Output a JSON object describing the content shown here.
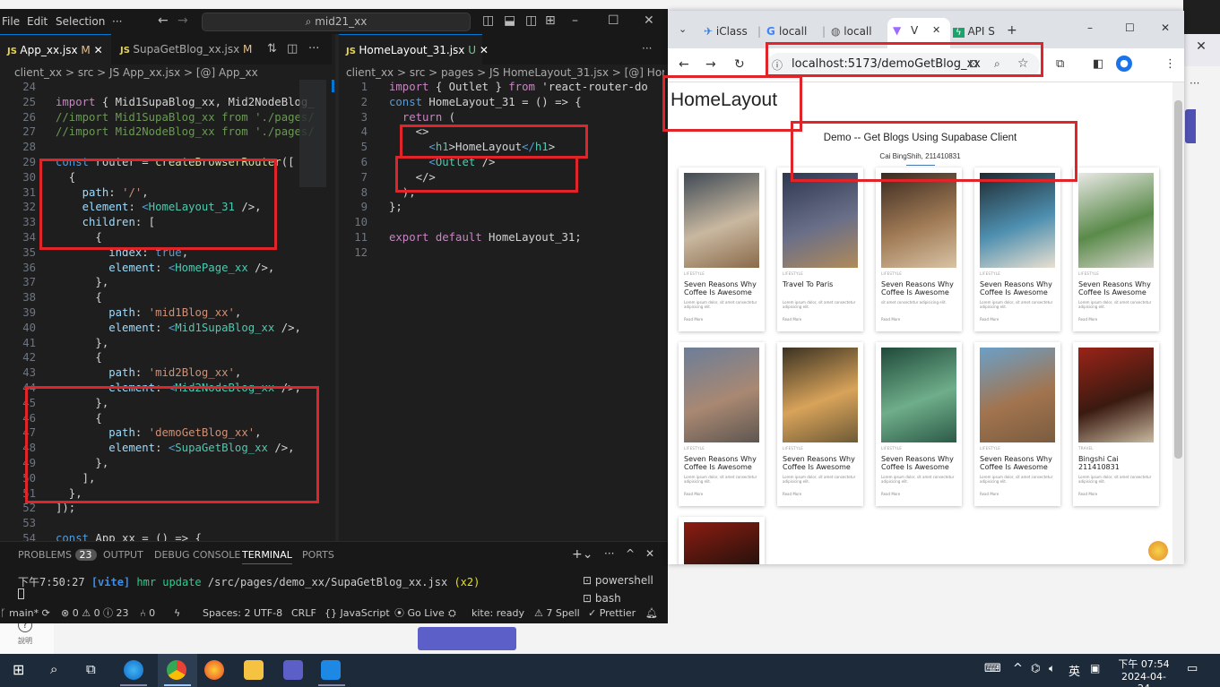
{
  "vscode": {
    "menu": [
      "File",
      "Edit",
      "Selection",
      "···"
    ],
    "search": "mid21_xx",
    "left_tabs": [
      {
        "label": "App_xx.jsx",
        "status": "M",
        "active": true
      },
      {
        "label": "SupaGetBlog_xx.jsx",
        "status": "M",
        "active": false
      }
    ],
    "right_tabs": [
      {
        "label": "HomeLayout_31.jsx",
        "status": "U",
        "active": true
      }
    ],
    "left_breadcrumb": "client_xx > src > JS App_xx.jsx > [@] App_xx",
    "right_breadcrumb": "client_xx > src > pages > JS HomeLayout_31.jsx > [@] HomeLayout_3",
    "left_line_numbers": [
      "24",
      "25",
      "26",
      "27",
      "28",
      "29",
      "30",
      "31",
      "32",
      "33",
      "34",
      "35",
      "36",
      "37",
      "38",
      "39",
      "40",
      "41",
      "42",
      "43",
      "44",
      "45",
      "46",
      "47",
      "48",
      "49",
      "50",
      "51",
      "52",
      "53",
      "54"
    ],
    "left_code": [
      "",
      "import { Mid1SupaBlog_xx, Mid2NodeBlog_",
      "//import Mid1SupaBlog_xx from './pages/",
      "//import Mid2NodeBlog_xx from './pages/",
      "",
      "const router = createBrowserRouter([",
      "  {",
      "    path: '/',",
      "    element: <HomeLayout_31 />,",
      "    children: [",
      "      {",
      "        index: true,",
      "        element: <HomePage_xx />,",
      "      },",
      "      {",
      "        path: 'mid1Blog_xx',",
      "        element: <Mid1SupaBlog_xx />,",
      "      },",
      "      {",
      "        path: 'mid2Blog_xx',",
      "        element: <Mid2NodeBlog_xx />,",
      "      },",
      "      {",
      "        path: 'demoGetBlog_xx',",
      "        element: <SupaGetBlog_xx />,",
      "      },",
      "    ],",
      "  },",
      "]);",
      "",
      "const App_xx = () => {"
    ],
    "right_line_numbers": [
      "1",
      "2",
      "3",
      "4",
      "5",
      "6",
      "7",
      "8",
      "9",
      "10",
      "11",
      "12"
    ],
    "right_code": [
      "import { Outlet } from 'react-router-do",
      "const HomeLayout_31 = () => {",
      "  return (",
      "    <>",
      "      <h1>HomeLayout</h1>",
      "      <Outlet />",
      "    </>",
      "  );",
      "};",
      "",
      "export default HomeLayout_31;",
      ""
    ],
    "panel_tabs": [
      "PROBLEMS",
      "OUTPUT",
      "DEBUG CONSOLE",
      "TERMINAL",
      "PORTS"
    ],
    "problems_count": "23",
    "terminal_time": "下午7:50:27",
    "terminal_tag": "[vite]",
    "terminal_msg": "hmr update",
    "terminal_path": "/src/pages/demo_xx/SupaGetBlog_xx.jsx",
    "terminal_count": "(x2)",
    "shells": [
      "powershell",
      "bash"
    ],
    "status": {
      "branch": "main*",
      "errors": "⊗ 0 ⚠ 0 ⓘ 23",
      "ports": "⑃ 0",
      "spaces": "Spaces: 2",
      "encoding": "UTF-8",
      "eol": "CRLF",
      "lang": "{} JavaScript",
      "golive": "Go Live",
      "kite": "kite: ready",
      "spell": "⚠ 7 Spell",
      "prettier": "✓ Prettier"
    }
  },
  "chrome": {
    "tabs": [
      {
        "label": "iClass"
      },
      {
        "label": "locall"
      },
      {
        "label": "locall"
      },
      {
        "label": "V"
      },
      {
        "label": "API S"
      }
    ],
    "url": "localhost:5173/demoGetBlog_xx"
  },
  "page": {
    "h1": "HomeLayout",
    "title": "Demo -- Get Blogs Using Supabase Client",
    "subtitle": "Cai BingShih, 211410831",
    "cards": [
      {
        "category": "LIFESTYLE",
        "title": "Seven Reasons Why Coffee Is Awesome",
        "desc": "Lorem ipsum dolor, sit amet consectetur adipisicing elit.",
        "more": "Read More",
        "img": [
          "#3f4a55",
          "#c9b8a0",
          "#8a6a4a"
        ]
      },
      {
        "category": "LIFESTYLE",
        "title": "Travel To Paris",
        "desc": "Lorem ipsum dolor, sit amet consectetur adipisicing elit.",
        "more": "Read More",
        "img": [
          "#2d3850",
          "#6a6f88",
          "#b08a5a"
        ]
      },
      {
        "category": "LIFESTYLE",
        "title": "Seven Reasons Why Coffee Is Awesome",
        "desc": "sit amet consectetur adipisicing elit.",
        "more": "Read More",
        "img": [
          "#3a2a20",
          "#a07a55",
          "#d8c3a5"
        ]
      },
      {
        "category": "LIFESTYLE",
        "title": "Seven Reasons Why Coffee Is Awesome",
        "desc": "Lorem ipsum dolor, sit amet consectetur adipisicing elit.",
        "more": "Read More",
        "img": [
          "#1e2a30",
          "#4e8fb0",
          "#e9e0d0"
        ]
      },
      {
        "category": "LIFESTYLE",
        "title": "Seven Reasons Why Coffee Is Awesome",
        "desc": "Lorem ipsum dolor, sit amet consectetur adipisicing elit.",
        "more": "Read More",
        "img": [
          "#e8e8e4",
          "#5a8a4a",
          "#d9d6cf"
        ]
      },
      {
        "category": "LIFESTYLE",
        "title": "Seven Reasons Why Coffee Is Awesome",
        "desc": "Lorem ipsum dolor, sit amet consectetur adipisicing elit.",
        "more": "Read More",
        "img": [
          "#6c7e98",
          "#a98872",
          "#5e5650"
        ]
      },
      {
        "category": "LIFESTYLE",
        "title": "Seven Reasons Why Coffee Is Awesome",
        "desc": "Lorem ipsum dolor, sit amet consectetur adipisicing elit.",
        "more": "Read More",
        "img": [
          "#3b3222",
          "#d8a35a",
          "#6e5a36"
        ]
      },
      {
        "category": "LIFESTYLE",
        "title": "Seven Reasons Why Coffee Is Awesome",
        "desc": "Lorem ipsum dolor, sit amet consectetur adipisicing elit.",
        "more": "Read More",
        "img": [
          "#1f4a3a",
          "#6fae8a",
          "#2c5a48"
        ]
      },
      {
        "category": "LIFESTYLE",
        "title": "Seven Reasons Why Coffee Is Awesome",
        "desc": "Lorem ipsum dolor, sit amet consectetur adipisicing elit.",
        "more": "Read More",
        "img": [
          "#6aa0c8",
          "#a2744e",
          "#7a5c40"
        ]
      },
      {
        "category": "TRAVEL",
        "title": "Bingshi Cai 211410831",
        "desc": "Lorem ipsum dolor, sit amet consectetur adipisicing elit.",
        "more": "Read More",
        "img": [
          "#9a2318",
          "#3a1a10",
          "#c9b9a0"
        ]
      },
      {
        "category": "",
        "title": "",
        "desc": "",
        "more": "",
        "img": [
          "#8c1c12",
          "#2a120c",
          "#c9b9a0"
        ]
      }
    ]
  },
  "taskbar": {
    "time": "下午 07:54",
    "date": "2024-04-24",
    "ime": "英",
    "help": "說明"
  }
}
